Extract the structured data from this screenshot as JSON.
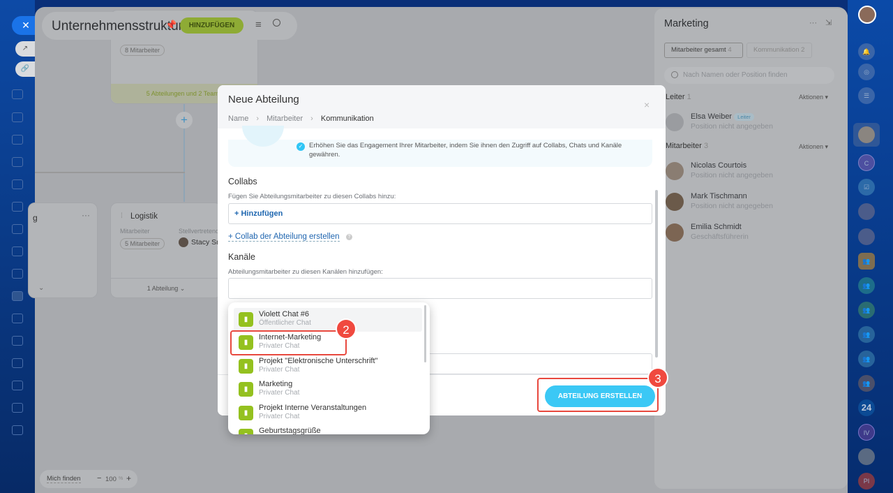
{
  "header": {
    "title": "Unternehmensstruktur",
    "add_label": "HINZUFÜGEN"
  },
  "canvas": {
    "top_card": {
      "employees": "8 Mitarbeiter",
      "footer": "5 Abteilungen und 2 Teams"
    },
    "left_card": {
      "title_fragment": "g"
    },
    "logistik": {
      "title": "Logistik",
      "employees_label": "Mitarbeiter",
      "employees": "5 Mitarbeiter",
      "deputy_label": "Stellvertretend",
      "deputy": "Stacy Sr",
      "footer": "1 Abteilung"
    },
    "find_me": "Mich finden",
    "zoom": "100",
    "zoom_unit": "%",
    "zoom_minus": "−",
    "zoom_plus": "+"
  },
  "modal": {
    "title": "Neue Abteilung",
    "breadcrumb": [
      "Name",
      "Mitarbeiter",
      "Kommunikation"
    ],
    "info": "Erhöhen Sie das Engagement Ihrer Mitarbeiter, indem Sie ihnen den Zugriff auf Collabs, Chats und Kanäle gewähren.",
    "collabs_title": "Collabs",
    "collabs_hint": "Fügen Sie Abteilungsmitarbeiter zu diesen Collabs hinzu:",
    "collabs_add": "+ Hinzufügen",
    "create_collab": "+ Collab der Abteilung erstellen",
    "channels_title": "Kanäle",
    "channels_hint": "Abteilungsmitarbeiter zu diesen Kanälen hinzufügen:",
    "create_button": "ABTEILUNG ERSTELLEN"
  },
  "dropdown": [
    {
      "title": "Violett Chat #6",
      "subtitle": "Öffentlicher Chat"
    },
    {
      "title": "Internet-Marketing",
      "subtitle": "Privater Chat"
    },
    {
      "title": "Projekt \"Elektronische Unterschrift\"",
      "subtitle": "Privater Chat"
    },
    {
      "title": "Marketing",
      "subtitle": "Privater Chat"
    },
    {
      "title": "Projekt Interne Veranstaltungen",
      "subtitle": "Privater Chat"
    },
    {
      "title": "Geburtstagsgrüße",
      "subtitle": ""
    }
  ],
  "annotations": {
    "step2": "2",
    "step3": "3"
  },
  "panel": {
    "title": "Marketing",
    "tabs": [
      {
        "label": "Mitarbeiter gesamt",
        "count": "4"
      },
      {
        "label": "Kommunikation",
        "count": "2"
      }
    ],
    "search_placeholder": "Nach Namen oder Position finden",
    "leader_section": "Leiter",
    "leader_count": "1",
    "actions": "Aktionen",
    "leader": {
      "name": "Elsa Weiber",
      "badge": "Leiter",
      "position": "Position nicht angegeben"
    },
    "staff_section": "Mitarbeiter",
    "staff_count": "3",
    "staff": [
      {
        "name": "Nicolas Courtois",
        "position": "Position nicht angegeben"
      },
      {
        "name": "Mark Tischmann",
        "position": "Position nicht angegeben"
      },
      {
        "name": "Emilia Schmidt",
        "position": "Geschäftsführerin"
      }
    ]
  },
  "rail": {
    "c": "C",
    "n24": "24",
    "iv": "IV",
    "pi": "PI"
  }
}
